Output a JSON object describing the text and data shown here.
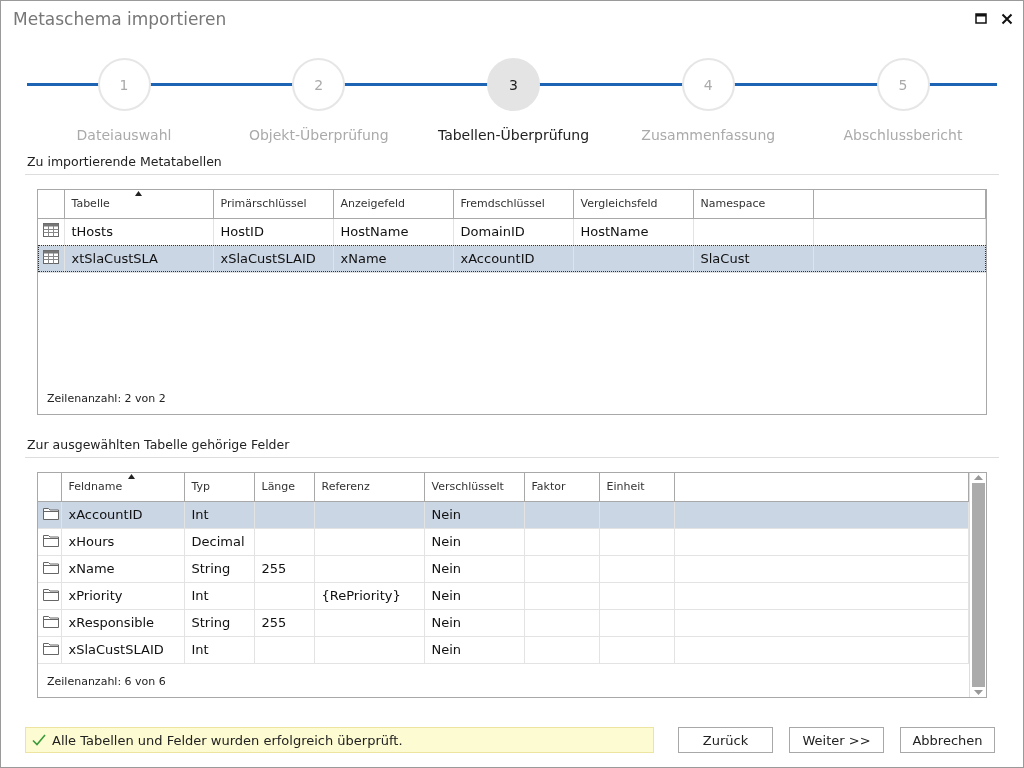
{
  "window": {
    "title": "Metaschema importieren"
  },
  "steps": [
    {
      "number": "1",
      "label": "Dateiauswahl",
      "selected": false
    },
    {
      "number": "2",
      "label": "Objekt-Überprüfung",
      "selected": false
    },
    {
      "number": "3",
      "label": "Tabellen-Überprüfung",
      "selected": true
    },
    {
      "number": "4",
      "label": "Zusammenfassung",
      "selected": false
    },
    {
      "number": "5",
      "label": "Abschlussbericht",
      "selected": false
    }
  ],
  "tables_section": {
    "title": "Zu importierende Metatabellen",
    "columns": [
      {
        "label": "Tabelle",
        "sorted": true
      },
      {
        "label": "Primärschlüssel",
        "sorted": false
      },
      {
        "label": "Anzeigefeld",
        "sorted": false
      },
      {
        "label": "Fremdschlüssel",
        "sorted": false
      },
      {
        "label": "Vergleichsfeld",
        "sorted": false
      },
      {
        "label": "Namespace",
        "sorted": false
      }
    ],
    "rows": [
      {
        "cells": [
          "tHosts",
          "HostID",
          "HostName",
          "DomainID",
          "HostName",
          ""
        ],
        "selected": false
      },
      {
        "cells": [
          "xtSlaCustSLA",
          "xSlaCustSLAID",
          "xName",
          "xAccountID",
          "",
          "SlaCust"
        ],
        "selected": true
      }
    ],
    "row_count": "Zeilenanzahl: 2 von 2"
  },
  "fields_section": {
    "title": "Zur ausgewählten Tabelle gehörige Felder",
    "columns": [
      {
        "label": "Feldname",
        "sorted": true
      },
      {
        "label": "Typ",
        "sorted": false
      },
      {
        "label": "Länge",
        "sorted": false
      },
      {
        "label": "Referenz",
        "sorted": false
      },
      {
        "label": "Verschlüsselt",
        "sorted": false
      },
      {
        "label": "Faktor",
        "sorted": false
      },
      {
        "label": "Einheit",
        "sorted": false
      }
    ],
    "rows": [
      {
        "cells": [
          "xAccountID",
          "Int",
          "",
          "",
          "Nein",
          "",
          ""
        ],
        "selected": true
      },
      {
        "cells": [
          "xHours",
          "Decimal",
          "",
          "",
          "Nein",
          "",
          ""
        ],
        "selected": false
      },
      {
        "cells": [
          "xName",
          "String",
          "255",
          "",
          "Nein",
          "",
          ""
        ],
        "selected": false
      },
      {
        "cells": [
          "xPriority",
          "Int",
          "",
          "{RePriority}",
          "Nein",
          "",
          ""
        ],
        "selected": false
      },
      {
        "cells": [
          "xResponsible",
          "String",
          "255",
          "",
          "Nein",
          "",
          ""
        ],
        "selected": false
      },
      {
        "cells": [
          "xSlaCustSLAID",
          "Int",
          "",
          "",
          "Nein",
          "",
          ""
        ],
        "selected": false
      }
    ],
    "row_count": "Zeilenanzahl: 6 von 6"
  },
  "status": {
    "message": "Alle Tabellen und Felder wurden erfolgreich überprüft."
  },
  "buttons": [
    "Zurück",
    "Weiter >>",
    "Abbrechen"
  ]
}
